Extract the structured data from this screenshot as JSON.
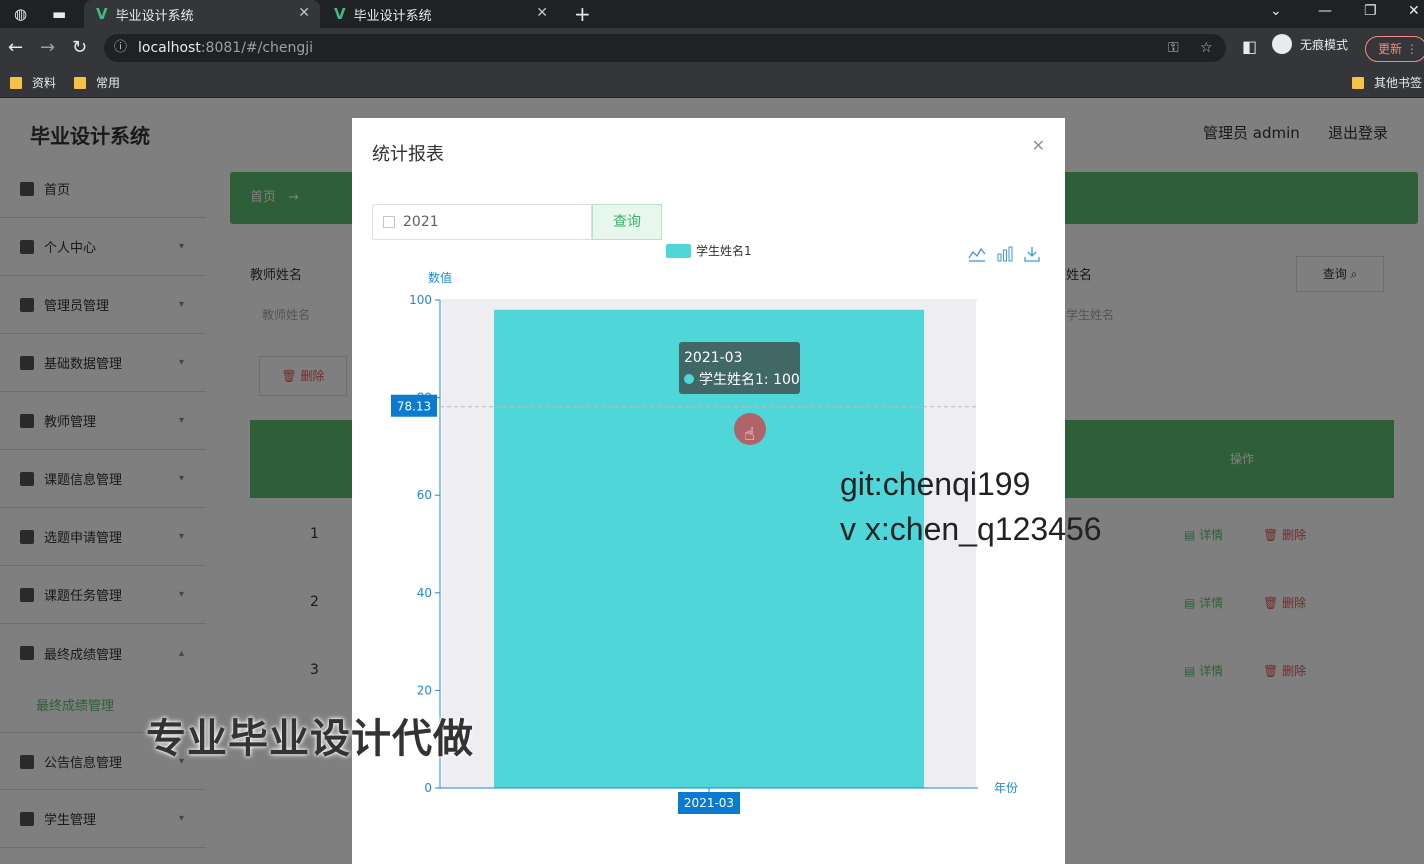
{
  "browser": {
    "tabs": [
      {
        "title": "毕业设计系统",
        "active": true
      },
      {
        "title": "毕业设计系统",
        "active": false
      }
    ],
    "url_host": "localhost",
    "url_rest": ":8081/#/chengji",
    "incognito_label": "无痕模式",
    "update_label": "更新",
    "bookmarks": [
      "资料",
      "常用"
    ],
    "other_bookmarks": "其他书签"
  },
  "app": {
    "title": "毕业设计系统",
    "user_label": "管理员 admin",
    "logout_label": "退出登录",
    "menu": [
      {
        "label": "首页"
      },
      {
        "label": "个人中心"
      },
      {
        "label": "管理员管理"
      },
      {
        "label": "基础数据管理"
      },
      {
        "label": "教师管理"
      },
      {
        "label": "课题信息管理"
      },
      {
        "label": "选题申请管理"
      },
      {
        "label": "课题任务管理"
      },
      {
        "label": "最终成绩管理"
      },
      {
        "label": "公告信息管理"
      },
      {
        "label": "学生管理"
      }
    ],
    "submenu_active": "最终成绩管理",
    "breadcrumb_home": "首页",
    "breadcrumb_arrow": "→",
    "teacher_label": "教师姓名",
    "teacher_placeholder": "教师姓名",
    "student_label": "姓名",
    "student_placeholder": "学生姓名",
    "search_btn": "查询",
    "delete_btn": "删除",
    "table_action_header": "操作",
    "rows": [
      {
        "num": "1",
        "detail": "详情",
        "delete": "删除"
      },
      {
        "num": "2",
        "detail": "详情",
        "delete": "删除"
      },
      {
        "num": "3",
        "detail": "详情",
        "delete": "删除"
      }
    ]
  },
  "modal": {
    "title": "统计报表",
    "close_icon": "close-icon",
    "date_value": "2021",
    "query_label": "查询",
    "toolbox_icons": [
      "line-chart-icon",
      "bar-chart-icon",
      "download-icon"
    ]
  },
  "chart_data": {
    "type": "bar",
    "categories": [
      "2021-03"
    ],
    "series": [
      {
        "name": "学生姓名1",
        "values": [
          98
        ],
        "color": "#4fd6d8"
      }
    ],
    "ylabel": "数值",
    "xlabel": "年份",
    "ylim": [
      0,
      100
    ],
    "yticks": [
      0,
      20,
      40,
      60,
      80,
      100
    ],
    "legend": "top-center",
    "axis_pointer": {
      "y": 78.13,
      "x": "2021-03"
    },
    "tooltip": {
      "title": "2021-03",
      "series": "学生姓名1",
      "value": "100"
    },
    "colors": {
      "axis": "#1d8ad6",
      "pointer_label": "#0a7bd1"
    }
  },
  "overlays": {
    "watermark_line1": "git:chenqi199",
    "watermark_line2": "v x:chen_q123456",
    "ad_text": "专业毕业设计代做"
  }
}
